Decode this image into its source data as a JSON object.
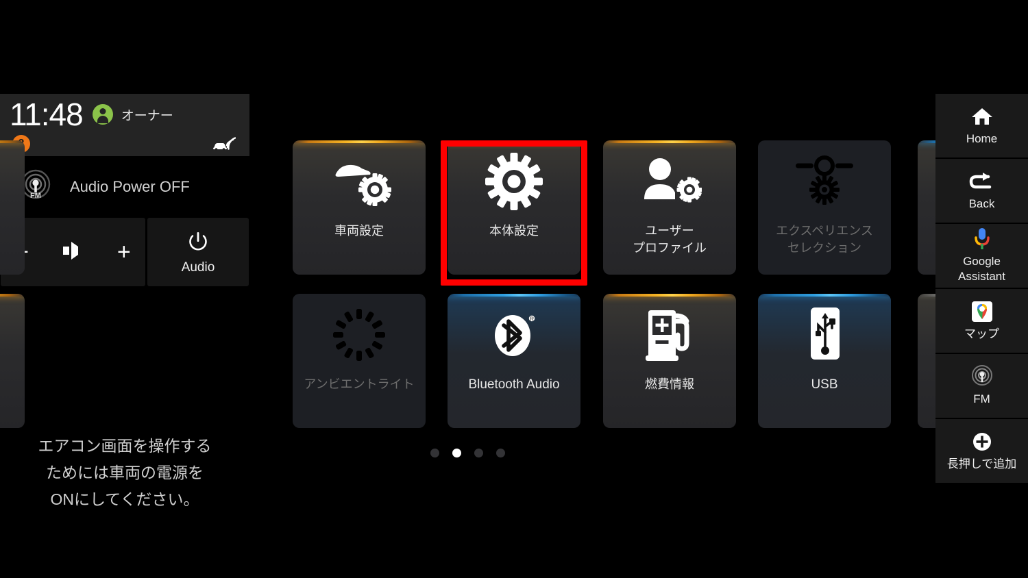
{
  "status_bar": {
    "time": "11:48",
    "user_name": "オーナー",
    "notification_count": "2",
    "avatar_icon": "person-avatar-icon",
    "connectivity_icon": "connected-car-icon"
  },
  "audio_widget": {
    "source_icon": "fm-radio-icon",
    "now_playing": "Audio Power OFF",
    "volume_down": "−",
    "volume_icon": "speaker-icon",
    "volume_up": "+",
    "power_icon": "power-icon",
    "power_label": "Audio"
  },
  "hvac_message": "エアコン画面を操作する\nためには車両の電源を\nONにしてください。",
  "grid": {
    "rows": [
      [
        {
          "label": "車両設定",
          "icon": "vehicle-settings-icon",
          "accent": "amber",
          "state": "enabled"
        },
        {
          "label": "本体設定",
          "icon": "system-settings-gear-icon",
          "accent": "amber",
          "state": "enabled",
          "highlighted": true
        },
        {
          "label": "ユーザー\nプロファイル",
          "icon": "user-profile-settings-icon",
          "accent": "amber",
          "state": "enabled"
        },
        {
          "label": "エクスペリエンス\nセレクション",
          "icon": "experience-selection-icon",
          "accent": "none",
          "state": "disabled"
        }
      ],
      [
        {
          "label": "アンビエントライト",
          "icon": "ambient-light-icon",
          "accent": "none",
          "state": "disabled"
        },
        {
          "label": "Bluetooth Audio",
          "icon": "bluetooth-icon",
          "accent": "blue",
          "state": "enabled"
        },
        {
          "label": "燃費情報",
          "icon": "fuel-economy-icon",
          "accent": "amber",
          "state": "enabled"
        },
        {
          "label": "USB",
          "icon": "usb-icon",
          "accent": "blue",
          "state": "enabled"
        }
      ]
    ],
    "page_dots": {
      "total": 4,
      "active_index": 1
    }
  },
  "sidebar": {
    "items": [
      {
        "label": "Home",
        "icon": "home-icon"
      },
      {
        "label": "Back",
        "icon": "back-arrow-icon"
      },
      {
        "label": "Google\nAssistant",
        "icon": "google-assistant-mic-icon"
      },
      {
        "label": "マップ",
        "icon": "google-maps-icon"
      },
      {
        "label": "FM",
        "icon": "fm-radio-icon"
      },
      {
        "label": "長押しで追加",
        "icon": "plus-circle-icon"
      }
    ]
  },
  "colors": {
    "accent_amber": "#f5b324",
    "accent_blue": "#2f9fe0",
    "highlight_red": "#ff0000",
    "avatar_green": "#8bc34a",
    "badge_orange": "#f07818",
    "background": "#000000",
    "tile_bg": "#2b2b2d",
    "tile_disabled_bg": "#1d1f24"
  }
}
